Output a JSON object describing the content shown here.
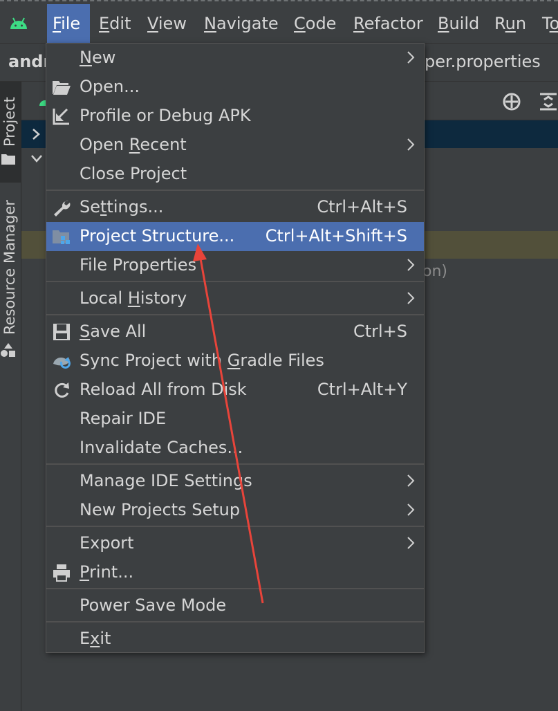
{
  "menubar": {
    "items": [
      "File",
      "Edit",
      "View",
      "Navigate",
      "Code",
      "Refactor",
      "Build",
      "Run",
      "To"
    ],
    "mnemonics": [
      "F",
      "E",
      "V",
      "N",
      "C",
      "R",
      "B",
      "u",
      "o"
    ]
  },
  "navbar": {
    "project_fragment": "andr",
    "file_fragment": "per.properties"
  },
  "tool_windows": {
    "project": "Project",
    "resource_manager": "Resource Manager"
  },
  "tree": {
    "hint_fragment": "on)"
  },
  "file_menu": {
    "items": [
      {
        "pre": "",
        "u": "N",
        "post": "ew",
        "shortcut": "",
        "submenu": true
      },
      {
        "pre": "",
        "u": "",
        "post": "Open...",
        "shortcut": "",
        "submenu": false
      },
      {
        "pre": "",
        "u": "",
        "post": "Profile or Debug APK",
        "shortcut": "",
        "submenu": false
      },
      {
        "pre": "Open ",
        "u": "R",
        "post": "ecent",
        "shortcut": "",
        "submenu": true
      },
      {
        "pre": "Close Project",
        "u": "",
        "post": "",
        "shortcut": "",
        "submenu": false
      },
      {
        "pre": "Se",
        "u": "t",
        "post": "tings...",
        "shortcut": "Ctrl+Alt+S",
        "submenu": false
      },
      {
        "pre": "Project Structure...",
        "u": "",
        "post": "",
        "shortcut": "Ctrl+Alt+Shift+S",
        "submenu": false
      },
      {
        "pre": "File Properties",
        "u": "",
        "post": "",
        "shortcut": "",
        "submenu": true
      },
      {
        "pre": "Local ",
        "u": "H",
        "post": "istory",
        "shortcut": "",
        "submenu": true
      },
      {
        "pre": "",
        "u": "S",
        "post": "ave All",
        "shortcut": "Ctrl+S",
        "submenu": false
      },
      {
        "pre": "Sync Project with ",
        "u": "G",
        "post": "radle Files",
        "shortcut": "",
        "submenu": false
      },
      {
        "pre": "Reload All from Disk",
        "u": "",
        "post": "",
        "shortcut": "Ctrl+Alt+Y",
        "submenu": false
      },
      {
        "pre": "Repair IDE",
        "u": "",
        "post": "",
        "shortcut": "",
        "submenu": false
      },
      {
        "pre": "Invalidate Caches...",
        "u": "",
        "post": "",
        "shortcut": "",
        "submenu": false
      },
      {
        "pre": "Manage IDE Settings",
        "u": "",
        "post": "",
        "shortcut": "",
        "submenu": true
      },
      {
        "pre": "New Projects Setup",
        "u": "",
        "post": "",
        "shortcut": "",
        "submenu": true
      },
      {
        "pre": "Export",
        "u": "",
        "post": "",
        "shortcut": "",
        "submenu": true
      },
      {
        "pre": "",
        "u": "P",
        "post": "rint...",
        "shortcut": "",
        "submenu": false
      },
      {
        "pre": "Power Save Mode",
        "u": "",
        "post": "",
        "shortcut": "",
        "submenu": false
      },
      {
        "pre": "E",
        "u": "x",
        "post": "it",
        "shortcut": "",
        "submenu": false
      }
    ],
    "icons": [
      "",
      "folder-open-icon",
      "profile-apk-icon",
      "",
      "",
      "wrench-icon",
      "project-structure-icon",
      "",
      "",
      "save-icon",
      "gradle-sync-icon",
      "reload-icon",
      "",
      "",
      "",
      "",
      "",
      "printer-icon",
      "",
      ""
    ],
    "selected_index": 6
  },
  "colors": {
    "background": "#3c3f41",
    "selection": "#4b6eaf",
    "annotation_arrow": "#e8443a",
    "android_green": "#3ddc84"
  }
}
